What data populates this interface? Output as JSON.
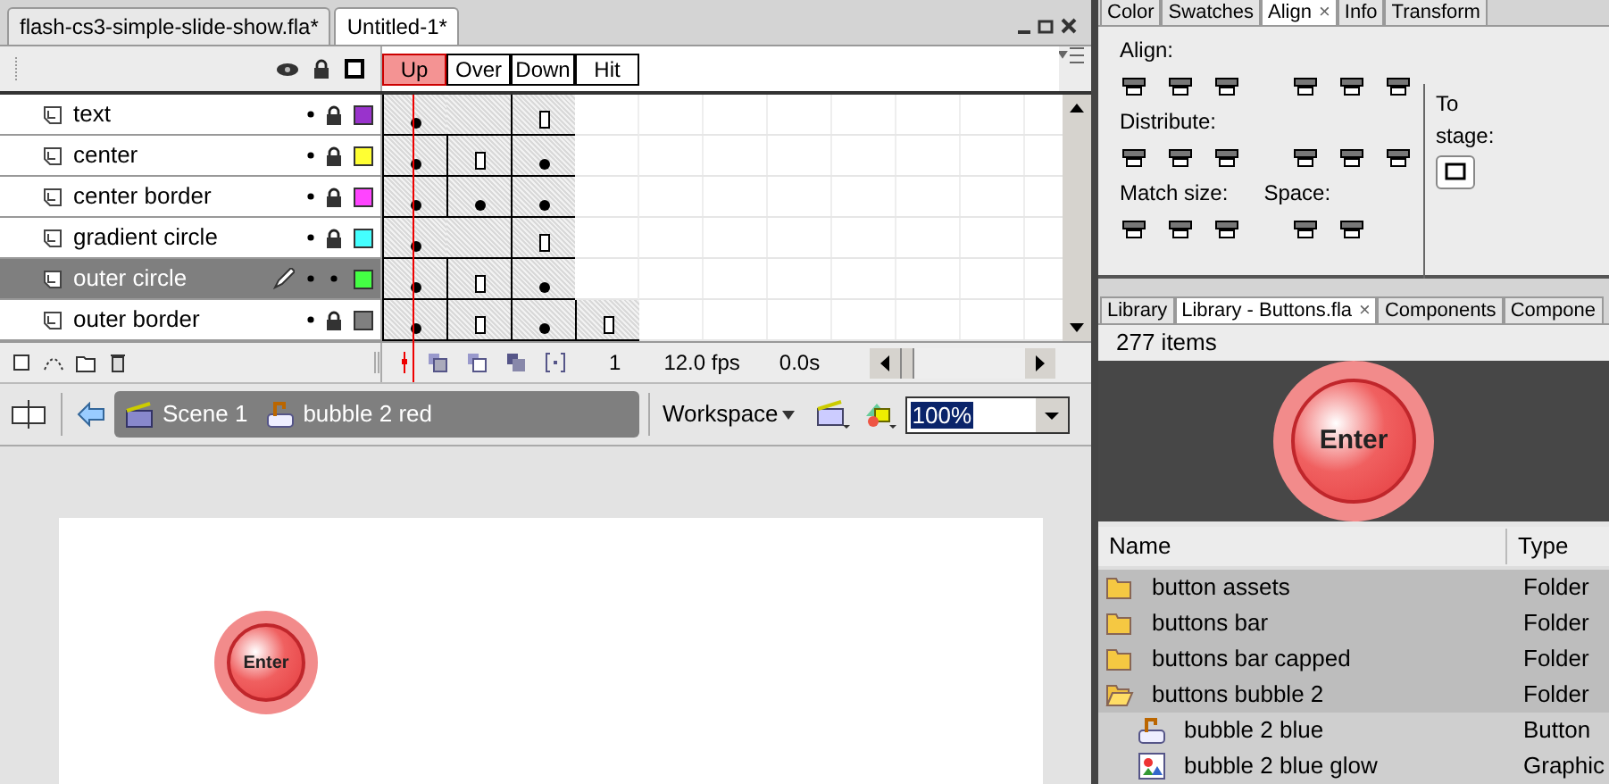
{
  "document_tabs": [
    {
      "label": "flash-cs3-simple-slide-show.fla*",
      "selected": false
    },
    {
      "label": "Untitled-1*",
      "selected": true
    }
  ],
  "timeline": {
    "frame_labels": [
      {
        "label": "Up",
        "selected": true
      },
      {
        "label": "Over",
        "selected": false
      },
      {
        "label": "Down",
        "selected": false
      },
      {
        "label": "Hit",
        "selected": false
      }
    ],
    "layers": [
      {
        "name": "text",
        "selected": false,
        "locked": true,
        "color": "#9933cc",
        "frames": [
          {
            "kind": "keyframe"
          },
          {
            "kind": "frame"
          },
          {
            "kind": "blank"
          },
          {
            "kind": "none"
          }
        ]
      },
      {
        "name": "center",
        "selected": false,
        "locked": true,
        "color": "#ffff33",
        "frames": [
          {
            "kind": "keyframe"
          },
          {
            "kind": "blank"
          },
          {
            "kind": "keyframe"
          },
          {
            "kind": "none"
          }
        ]
      },
      {
        "name": "center border",
        "selected": false,
        "locked": true,
        "color": "#ff44ff",
        "frames": [
          {
            "kind": "keyframe"
          },
          {
            "kind": "keyframe"
          },
          {
            "kind": "keyframe"
          },
          {
            "kind": "none"
          }
        ]
      },
      {
        "name": "gradient circle",
        "selected": false,
        "locked": true,
        "color": "#44ffff",
        "frames": [
          {
            "kind": "keyframe"
          },
          {
            "kind": "frame"
          },
          {
            "kind": "blank"
          },
          {
            "kind": "none"
          }
        ]
      },
      {
        "name": "outer circle",
        "selected": true,
        "locked": false,
        "color": "#44ff44",
        "frames": [
          {
            "kind": "keyframe"
          },
          {
            "kind": "blank"
          },
          {
            "kind": "keyframe"
          },
          {
            "kind": "none"
          }
        ]
      },
      {
        "name": "outer border",
        "selected": false,
        "locked": true,
        "color": "#808080",
        "frames": [
          {
            "kind": "keyframe"
          },
          {
            "kind": "blank"
          },
          {
            "kind": "keyframe"
          },
          {
            "kind": "blank"
          }
        ]
      }
    ],
    "current_frame": "1",
    "frame_rate": "12.0 fps",
    "elapsed_time": "0.0s"
  },
  "edit_bar": {
    "breadcrumbs": [
      {
        "label": "Scene 1",
        "kind": "scene"
      },
      {
        "label": "bubble 2 red",
        "kind": "button"
      }
    ],
    "workspace_menu": "Workspace",
    "zoom": "100%"
  },
  "stage": {
    "button_label": "Enter"
  },
  "align_panel": {
    "tabs": [
      {
        "label": "Color",
        "selected": false
      },
      {
        "label": "Swatches",
        "selected": false
      },
      {
        "label": "Align",
        "selected": true
      },
      {
        "label": "Info",
        "selected": false
      },
      {
        "label": "Transform",
        "selected": false
      }
    ],
    "close": "×",
    "align_label": "Align:",
    "distribute_label": "Distribute:",
    "match_size_label": "Match size:",
    "space_label": "Space:",
    "to_label": "To",
    "stage_label": "stage:"
  },
  "library_panel": {
    "tabs": [
      {
        "label": "Library",
        "selected": false
      },
      {
        "label": "Library - Buttons.fla",
        "selected": true
      },
      {
        "label": "Components",
        "selected": false
      },
      {
        "label": "Compone",
        "selected": false
      }
    ],
    "close": "×",
    "item_count": "277 items",
    "preview_label": "Enter",
    "columns": [
      "Name",
      "Type"
    ],
    "items": [
      {
        "name": "button assets",
        "type": "Folder",
        "kind": "folder",
        "expanded": false
      },
      {
        "name": "buttons bar",
        "type": "Folder",
        "kind": "folder",
        "expanded": false
      },
      {
        "name": "buttons bar capped",
        "type": "Folder",
        "kind": "folder",
        "expanded": false
      },
      {
        "name": "buttons bubble 2",
        "type": "Folder",
        "kind": "folder",
        "expanded": true,
        "children": [
          {
            "name": "bubble 2 blue",
            "type": "Button",
            "kind": "button"
          },
          {
            "name": "bubble 2 blue glow",
            "type": "Graphic",
            "kind": "graphic"
          }
        ]
      }
    ]
  }
}
